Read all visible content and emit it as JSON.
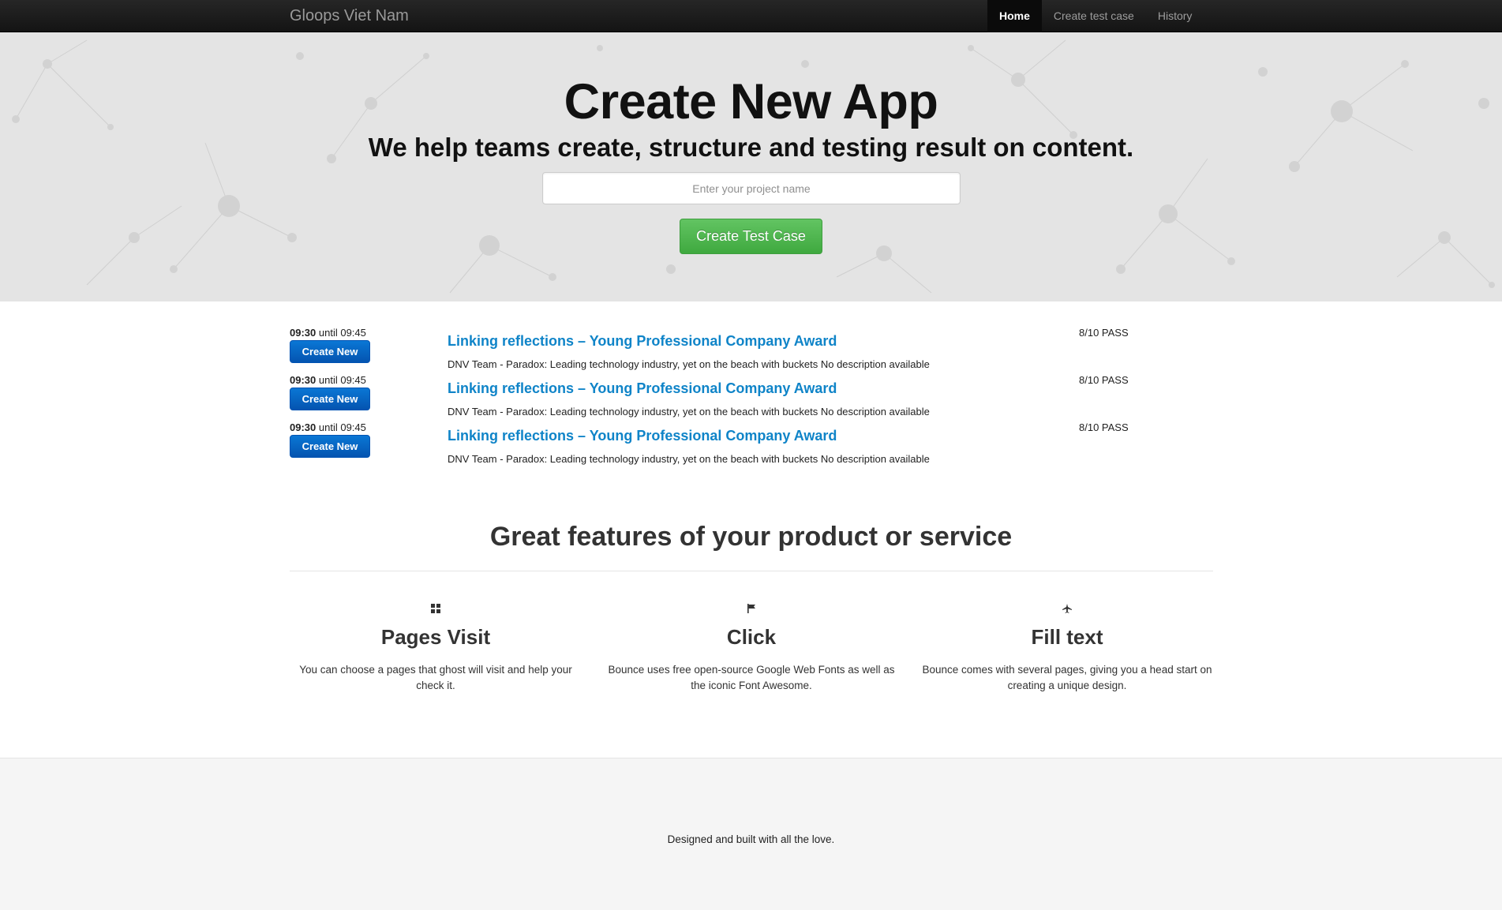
{
  "navbar": {
    "brand": "Gloops Viet Nam",
    "items": [
      {
        "label": "Home"
      },
      {
        "label": "Create test case"
      },
      {
        "label": "History"
      }
    ]
  },
  "hero": {
    "title": "Create New App",
    "subtitle": "We help teams create, structure and testing result on content.",
    "input_placeholder": "Enter your project name",
    "input_value": "",
    "button_label": "Create Test Case"
  },
  "schedule": [
    {
      "time_start": "09:30",
      "time_rest": "until 09:45",
      "button_label": "Create New",
      "title": "Linking reflections – Young Professional Company Award",
      "description": "DNV Team - Paradox: Leading technology industry, yet on the beach with buckets No description available",
      "score": "8/10 PASS"
    },
    {
      "time_start": "09:30",
      "time_rest": "until 09:45",
      "button_label": "Create New",
      "title": "Linking reflections – Young Professional Company Award",
      "description": "DNV Team - Paradox: Leading technology industry, yet on the beach with buckets No description available",
      "score": "8/10 PASS"
    },
    {
      "time_start": "09:30",
      "time_rest": "until 09:45",
      "button_label": "Create New",
      "title": "Linking reflections – Young Professional Company Award",
      "description": "DNV Team - Paradox: Leading technology industry, yet on the beach with buckets No description available",
      "score": "8/10 PASS"
    }
  ],
  "features": {
    "title": "Great features of your product or service",
    "items": [
      {
        "icon": "grid-icon",
        "title": "Pages Visit",
        "text": "You can choose a pages that ghost will visit and help your check it."
      },
      {
        "icon": "flag-icon",
        "title": "Click",
        "text": "Bounce uses free open-source Google Web Fonts as well as the iconic Font Awesome."
      },
      {
        "icon": "plane-icon",
        "title": "Fill text",
        "text": "Bounce comes with several pages, giving you a head start on creating a unique design."
      }
    ]
  },
  "footer": {
    "text": "Designed and built with all the love."
  },
  "colors": {
    "navbar_bg": "#1a1a1a",
    "hero_bg": "#e4e4e4",
    "link_blue": "#0f84c8",
    "success_green": "#51b551",
    "primary_blue": "#0566c2",
    "footer_bg": "#f5f5f5"
  }
}
